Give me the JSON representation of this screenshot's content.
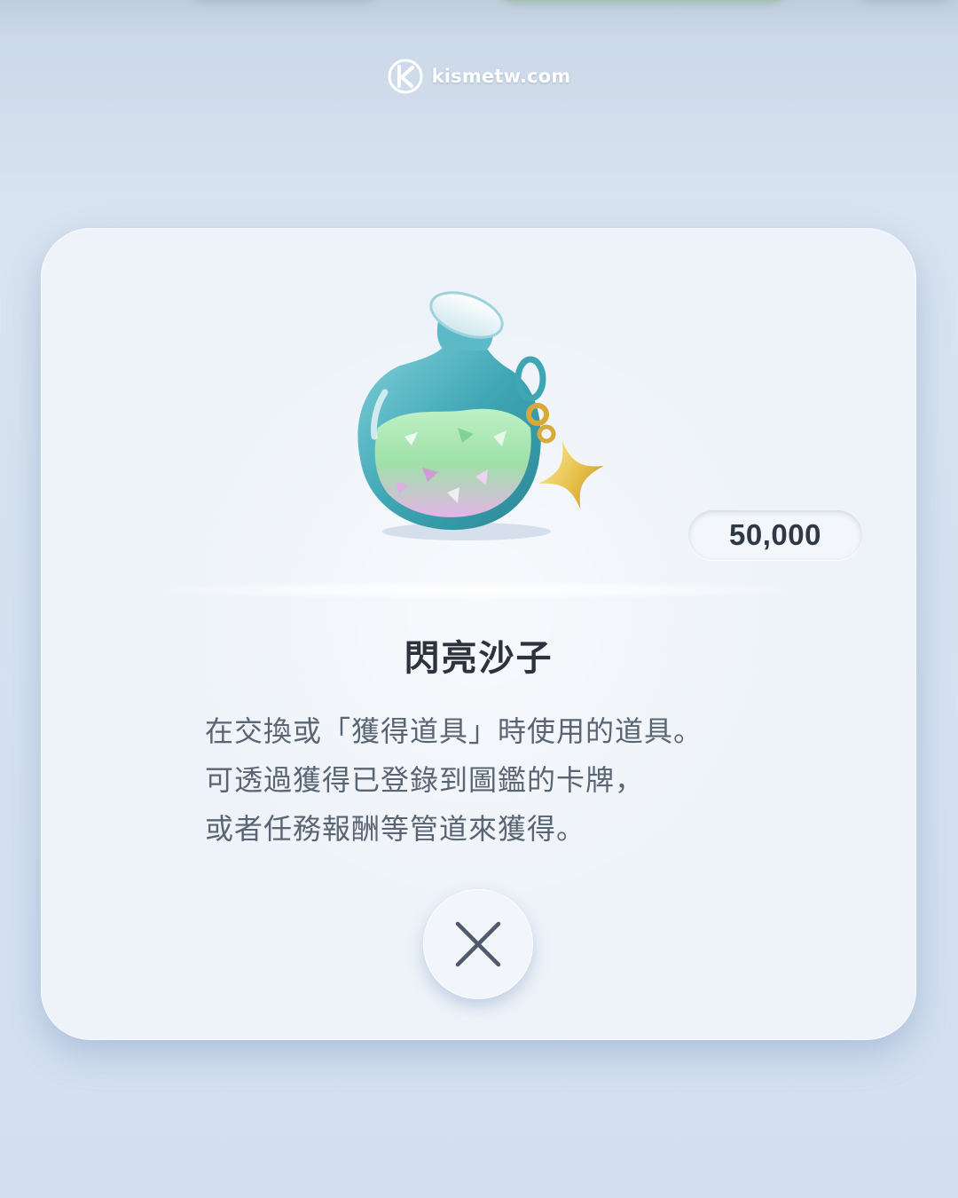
{
  "watermark": {
    "text": "kismetw.com",
    "icon": "kismet-logo-icon"
  },
  "item": {
    "name": "閃亮沙子",
    "icon": "shiny-sand-bottle-icon",
    "amount": "50,000",
    "description": [
      "在交換或「獲得道具」時使用的道具。",
      "可透過獲得已登錄到圖鑑的卡牌，",
      "或者任務報酬等管道來獲得。"
    ]
  },
  "close_button": {
    "icon": "close-icon"
  },
  "colors": {
    "card_background": "#eef3f9",
    "page_background": "#d6e2f0",
    "title_text": "#2c333d",
    "body_text": "#5a6573",
    "bottle_teal": "#3fa6b4",
    "star_gold": "#e7c04a"
  }
}
